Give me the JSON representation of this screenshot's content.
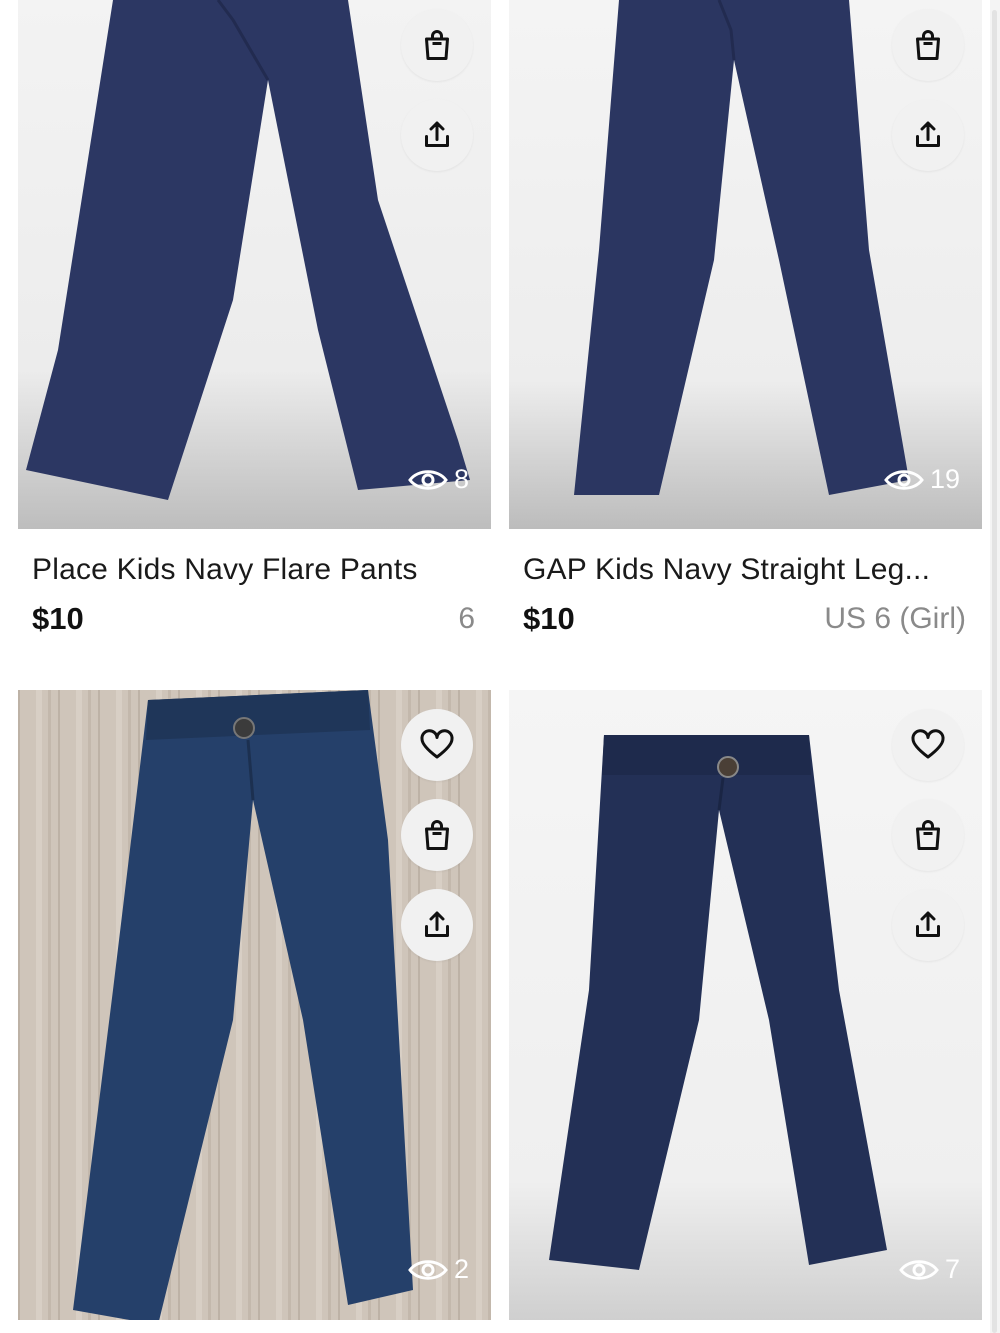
{
  "listings": [
    {
      "title": "Place Kids Navy Flare Pants",
      "price": "$10",
      "size": "6",
      "views": "8",
      "image": "navy-flare-pants-photo",
      "actions": [
        "bag-icon",
        "share-icon"
      ]
    },
    {
      "title": "GAP Kids Navy Straight Leg...",
      "price": "$10",
      "size": "US 6 (Girl)",
      "views": "19",
      "image": "navy-straight-leg-pants-photo",
      "actions": [
        "bag-icon",
        "share-icon"
      ]
    },
    {
      "views": "2",
      "image": "navy-skinny-pants-on-wood-photo",
      "actions": [
        "heart-icon",
        "bag-icon",
        "share-icon"
      ]
    },
    {
      "views": "7",
      "image": "navy-chino-pants-photo",
      "actions": [
        "heart-icon",
        "bag-icon",
        "share-icon"
      ]
    }
  ],
  "colors": {
    "navy_denim": "#2b3760",
    "wood_background": "#c9bfb4",
    "button_background": "#f1f1f1",
    "size_text": "#8a8a8a"
  }
}
